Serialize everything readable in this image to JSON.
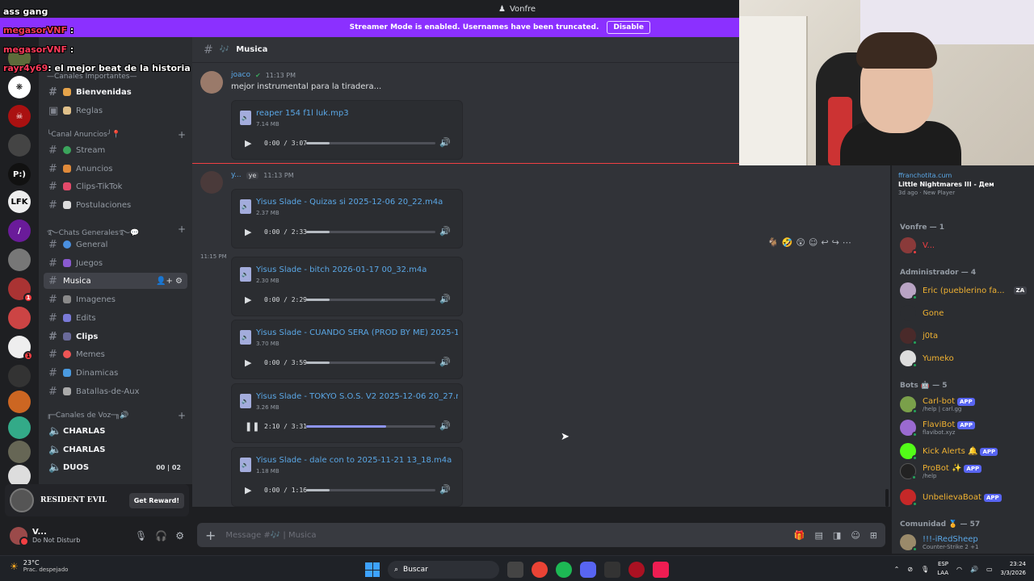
{
  "topbar": {
    "title": "Vonfre"
  },
  "banner": {
    "text": "Streamer Mode is enabled. Usernames have been truncated.",
    "button": "Disable"
  },
  "overlay": {
    "lines": [
      {
        "name": "ass gang",
        "text": ""
      },
      {
        "name": "megasorVNF",
        "text": ":"
      },
      {
        "name": "megasorVNF",
        "text": ":"
      },
      {
        "name": "rayr4y69",
        "text": ": el mejor beat de la historia watafak"
      }
    ]
  },
  "sidebar": {
    "categories": [
      {
        "label": "—Canales Importantes—"
      },
      {
        "label": "╰Canal Anuncios╯📍"
      },
      {
        "label": "࿐Chats Generales࿐💬"
      },
      {
        "label": "╓─Canales de Voz─╖🔊"
      }
    ],
    "channels": [
      {
        "label": "Bienvenidas",
        "bold": true
      },
      {
        "label": "Reglas"
      },
      {
        "label": "Stream"
      },
      {
        "label": "Anuncios"
      },
      {
        "label": "Clips-TikTok"
      },
      {
        "label": "Postulaciones"
      },
      {
        "label": "General"
      },
      {
        "label": "Juegos"
      },
      {
        "label": "Musica",
        "active": true
      },
      {
        "label": "Imagenes"
      },
      {
        "label": "Edits"
      },
      {
        "label": "Clips",
        "bold": true
      },
      {
        "label": "Memes"
      },
      {
        "label": "Dinamicas"
      },
      {
        "label": "Batallas-de-Aux"
      }
    ],
    "voice": [
      {
        "label": "CHARLAS"
      },
      {
        "label": "CHARLAS"
      },
      {
        "label": "DUOS",
        "count_a": "00",
        "count_b": "02"
      }
    ]
  },
  "promo": {
    "game": "RESIDENT EVIL",
    "button": "Get Reward!"
  },
  "user": {
    "name": "V...",
    "status": "Do Not Disturb"
  },
  "channel": {
    "name": "Musica"
  },
  "messages": {
    "m1": {
      "author": "joaco",
      "time": "11:13 PM",
      "text": "mejor instrumental para la tiradera..."
    },
    "m2": {
      "author": "y...",
      "tag": "ye",
      "time": "11:13 PM"
    },
    "ts3": "11:15 PM"
  },
  "attachments": [
    {
      "name": "reaper 154 f1l luk.mp3",
      "size": "7.14 MB",
      "time": "0:00 / 3:07",
      "progress": 0.0,
      "playing": false
    },
    {
      "name": "Yisus Slade - Quizas si 2025-12-06 20_22.m4a",
      "size": "2.37 MB",
      "time": "0:00 / 2:33",
      "progress": 0.0,
      "playing": false
    },
    {
      "name": "Yisus Slade - bitch 2026-01-17 00_32.m4a",
      "size": "2.30 MB",
      "time": "0:00 / 2:29",
      "progress": 0.0,
      "playing": false
    },
    {
      "name": "Yisus Slade - CUANDO SERA (PROD BY ME) 2025-12-1",
      "size": "3.70 MB",
      "time": "0:00 / 3:59",
      "progress": 0.0,
      "playing": false
    },
    {
      "name": "Yisus Slade - TOKYO S.O.S. V2 2025-12-06 20_27.m4a",
      "size": "3.26 MB",
      "time": "2:10 / 3:31",
      "progress": 0.62,
      "playing": true
    },
    {
      "name": "Yisus Slade - dale con to 2025-11-21 13_18.m4a",
      "size": "1.18 MB",
      "time": "0:00 / 1:16",
      "progress": 0.0,
      "playing": false
    }
  ],
  "composer": {
    "placeholder": "Message #🎶 | Musica"
  },
  "members": {
    "activity": {
      "who": "ffranchotita.cum",
      "game": "Little Nightmares III - Дем",
      "when": "3d ago",
      "tag": "New Player"
    },
    "groups": [
      {
        "label": "Vonfre — 1"
      },
      {
        "label": "Administrador — 4"
      },
      {
        "label": "Bots 🤖 — 5"
      },
      {
        "label": "Comunidad 🏅 — 57"
      }
    ],
    "list": [
      {
        "name": "V...",
        "color": "#f23f43",
        "sub": ""
      },
      {
        "name": "Eric (pueblerino fa...",
        "color": "#f0b232",
        "sub": ""
      },
      {
        "name": "Gone",
        "color": "#f0b232",
        "sub": ""
      },
      {
        "name": "j0ta",
        "color": "#f0b232",
        "sub": ""
      },
      {
        "name": "Yumeko",
        "color": "#f0b232",
        "sub": ""
      },
      {
        "name": "Carl-bot",
        "color": "#f0b232",
        "sub": "/help | carl.gg",
        "app": "APP"
      },
      {
        "name": "FlaviBot",
        "color": "#f0b232",
        "sub": "flavibot.xyz",
        "app": "APP"
      },
      {
        "name": "Kick Alerts 🔔",
        "color": "#f0b232",
        "sub": "",
        "app": "APP"
      },
      {
        "name": "ProBot ✨",
        "color": "#f0b232",
        "sub": "/help",
        "app": "APP"
      },
      {
        "name": "UnbelievaBoat",
        "color": "#f0b232",
        "sub": "",
        "app": "APP"
      },
      {
        "name": "!!!-iRedSheep",
        "color": "#5aa7e6",
        "sub": "Counter-Strike 2 +1"
      }
    ],
    "admin_badge": "ZA"
  },
  "taskbar": {
    "temp": "23°C",
    "weather": "Prac. despejado",
    "search": "Buscar",
    "lang_a": "ESP",
    "lang_b": "LAA",
    "time": "23:24",
    "date": "3/3/2026"
  }
}
